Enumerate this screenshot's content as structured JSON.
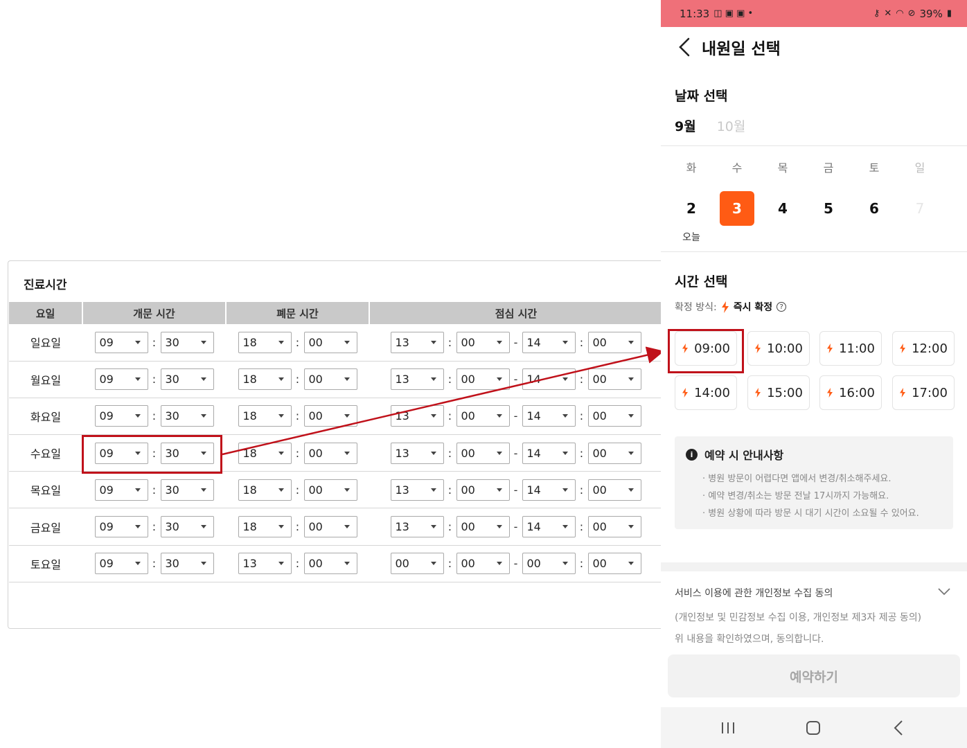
{
  "admin": {
    "title": "진료시간",
    "headers": {
      "day": "요일",
      "open": "개문 시간",
      "close": "폐문 시간",
      "lunch": "점심 시간"
    },
    "rows": [
      {
        "day": "일요일",
        "open_h": "09",
        "open_m": "30",
        "close_h": "18",
        "close_m": "00",
        "lunch_sh": "13",
        "lunch_sm": "00",
        "lunch_eh": "14",
        "lunch_em": "00"
      },
      {
        "day": "월요일",
        "open_h": "09",
        "open_m": "30",
        "close_h": "18",
        "close_m": "00",
        "lunch_sh": "13",
        "lunch_sm": "00",
        "lunch_eh": "14",
        "lunch_em": "00"
      },
      {
        "day": "화요일",
        "open_h": "09",
        "open_m": "30",
        "close_h": "18",
        "close_m": "00",
        "lunch_sh": "13",
        "lunch_sm": "00",
        "lunch_eh": "14",
        "lunch_em": "00"
      },
      {
        "day": "수요일",
        "open_h": "09",
        "open_m": "30",
        "close_h": "18",
        "close_m": "00",
        "lunch_sh": "13",
        "lunch_sm": "00",
        "lunch_eh": "14",
        "lunch_em": "00"
      },
      {
        "day": "목요일",
        "open_h": "09",
        "open_m": "30",
        "close_h": "18",
        "close_m": "00",
        "lunch_sh": "13",
        "lunch_sm": "00",
        "lunch_eh": "14",
        "lunch_em": "00"
      },
      {
        "day": "금요일",
        "open_h": "09",
        "open_m": "30",
        "close_h": "18",
        "close_m": "00",
        "lunch_sh": "13",
        "lunch_sm": "00",
        "lunch_eh": "14",
        "lunch_em": "00"
      },
      {
        "day": "토요일",
        "open_h": "09",
        "open_m": "30",
        "close_h": "13",
        "close_m": "00",
        "lunch_sh": "00",
        "lunch_sm": "00",
        "lunch_eh": "00",
        "lunch_em": "00"
      }
    ],
    "colon": ":",
    "dash": "-"
  },
  "status": {
    "time": "11:33",
    "battery": "39%"
  },
  "app": {
    "title": "내원일 선택",
    "date_section": "날짜 선택",
    "month_active": "9월",
    "month_inactive": "10월",
    "week": [
      {
        "dow": "화",
        "num": "2",
        "note": "오늘"
      },
      {
        "dow": "수",
        "num": "3",
        "selected": true
      },
      {
        "dow": "목",
        "num": "4"
      },
      {
        "dow": "금",
        "num": "5"
      },
      {
        "dow": "토",
        "num": "6"
      },
      {
        "dow": "일",
        "num": "7",
        "disabled": true
      }
    ],
    "time_section": "시간 선택",
    "confirm_label": "확정 방식:",
    "confirm_value": "즉시 확정",
    "help": "?",
    "slots": [
      "09:00",
      "10:00",
      "11:00",
      "12:00",
      "14:00",
      "15:00",
      "16:00",
      "17:00"
    ],
    "notice_title": "예약 시 안내사항",
    "notice_lines": [
      "· 병원 방문이 어렵다면 앱에서 변경/취소해주세요.",
      "· 예약 변경/취소는 방문 전날 17시까지 가능해요.",
      "· 병원 상황에 따라 방문 시 대기 시간이 소요될 수 있어요."
    ],
    "consent_title": "서비스 이용에 관한 개인정보 수집 동의",
    "consent_sub": "(개인정보 및 민감정보 수집 이용, 개인정보 제3자 제공 동의)",
    "consent_agree": "위 내용을 확인하였으며, 동의합니다.",
    "reserve_button": "예약하기"
  },
  "colors": {
    "accent": "#ff5b14",
    "annotation": "#c0111a",
    "status_bar": "#ef7079"
  }
}
